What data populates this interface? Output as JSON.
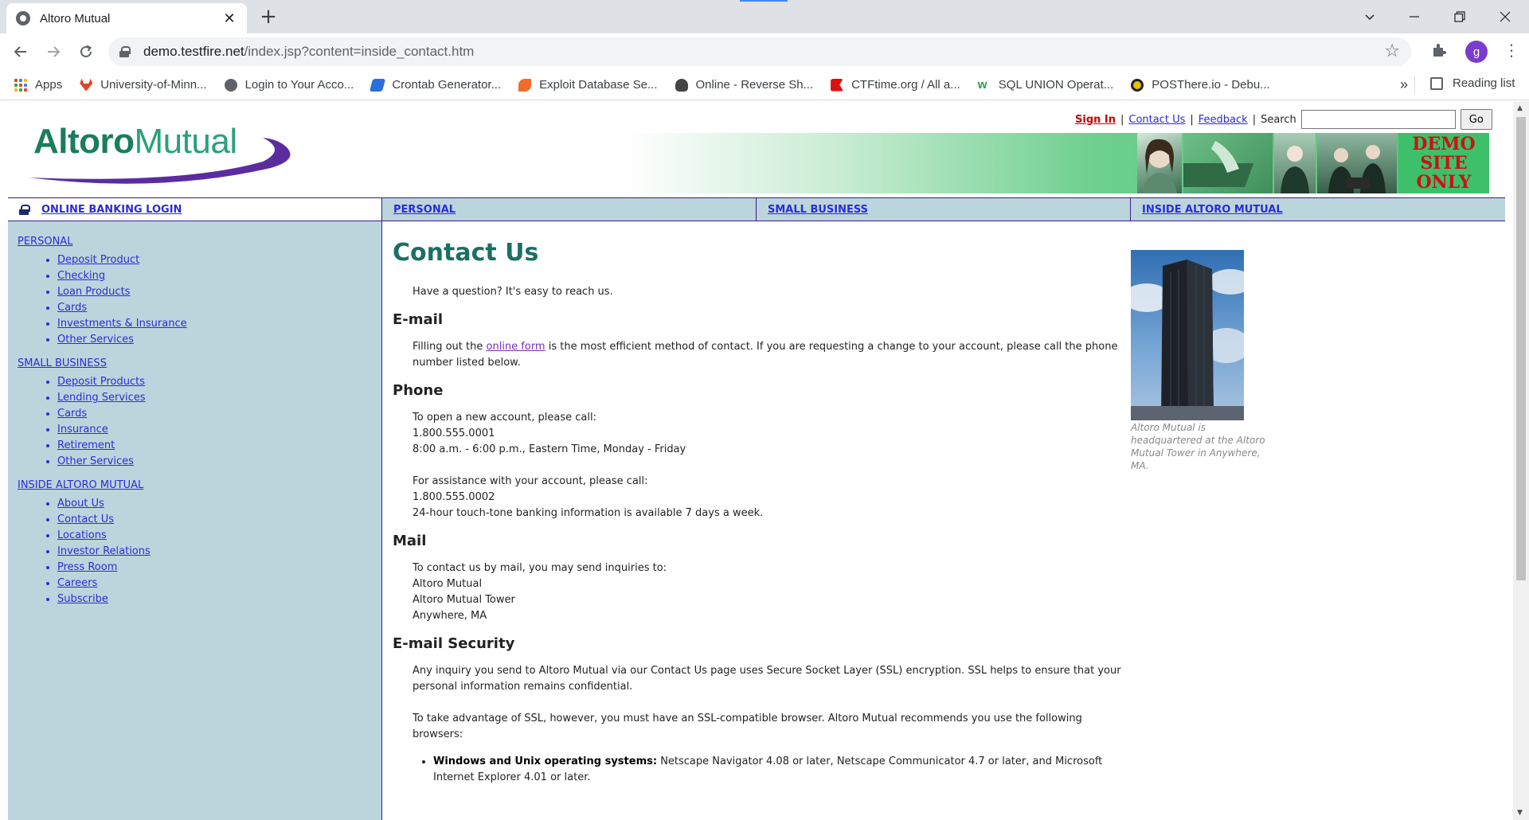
{
  "browser": {
    "tab_title": "Altoro Mutual",
    "tab_close": "✕",
    "new_tab": "+",
    "url_host": "demo.testfire.net",
    "url_path": "/index.jsp?content=inside_contact.htm",
    "avatar_letter": "g",
    "bookmarks": [
      {
        "label": "Apps",
        "icon": "apps-grid-icon",
        "color": "#4285f4"
      },
      {
        "label": "University-of-Minn...",
        "icon": "gitlab-icon",
        "color": "#e24329"
      },
      {
        "label": "Login to Your Acco...",
        "icon": "globe-icon",
        "color": "#5f6368"
      },
      {
        "label": "Crontab Generator...",
        "icon": "crontab-icon",
        "color": "#2a6fdb"
      },
      {
        "label": "Exploit Database Se...",
        "icon": "exploitdb-icon",
        "color": "#f26b2a"
      },
      {
        "label": "Online - Reverse Sh...",
        "icon": "skull-icon",
        "color": "#444444"
      },
      {
        "label": "CTFtime.org / All a...",
        "icon": "ctftime-icon",
        "color": "#e01010"
      },
      {
        "label": "SQL UNION Operat...",
        "icon": "w3schools-icon",
        "color": "#2e9a4a"
      },
      {
        "label": "POSThere.io - Debu...",
        "icon": "posthere-icon",
        "color": "#e6c100"
      }
    ],
    "bookmarks_more": "»",
    "reading_list": "Reading list"
  },
  "header": {
    "logo_bold": "Altoro",
    "logo_light": "Mutual",
    "sign_in": "Sign In",
    "contact_us": "Contact Us",
    "feedback": "Feedback",
    "search_label": "Search",
    "search_value": "",
    "go_label": "Go",
    "demo_badge": "DEMO SITE ONLY"
  },
  "nav": {
    "login": "ONLINE BANKING LOGIN",
    "personal": "PERSONAL",
    "small_business": "SMALL BUSINESS",
    "inside": "INSIDE ALTORO MUTUAL"
  },
  "sidebar": {
    "sections": [
      {
        "title": "PERSONAL",
        "items": [
          "Deposit Product",
          "Checking",
          "Loan Products",
          "Cards",
          "Investments & Insurance",
          "Other Services"
        ]
      },
      {
        "title": "SMALL BUSINESS",
        "items": [
          "Deposit Products",
          "Lending Services",
          "Cards",
          "Insurance",
          "Retirement",
          "Other Services"
        ]
      },
      {
        "title": "INSIDE ALTORO MUTUAL",
        "items": [
          "About Us",
          "Contact Us",
          "Locations",
          "Investor Relations",
          "Press Room",
          "Careers",
          "Subscribe"
        ]
      }
    ]
  },
  "content": {
    "title": "Contact Us",
    "intro": "Have a question? It's easy to reach us.",
    "email_heading": "E-mail",
    "email_pre": "Filling out the ",
    "email_link": "online form",
    "email_post": " is the most efficient method of contact. If you are requesting a change to your account, please call the phone number listed below.",
    "phone_heading": "Phone",
    "phone_new_1": "To open a new account, please call:",
    "phone_new_2": "1.800.555.0001",
    "phone_new_3": "8:00 a.m. - 6:00 p.m., Eastern Time, Monday - Friday",
    "phone_assist_1": "For assistance with your account, please call:",
    "phone_assist_2": "1.800.555.0002",
    "phone_assist_3": "24-hour touch-tone banking information is available 7 days a week.",
    "mail_heading": "Mail",
    "mail_1": "To contact us by mail, you may send inquiries to:",
    "mail_2": "Altoro Mutual",
    "mail_3": "Altoro Mutual Tower",
    "mail_4": "Anywhere, MA",
    "security_heading": "E-mail Security",
    "security_p1": "Any inquiry you send to Altoro Mutual via our Contact Us page uses Secure Socket Layer (SSL) encryption. SSL helps to ensure that your personal information remains confidential.",
    "security_p2": "To take advantage of SSL, however, you must have an SSL-compatible browser. Altoro Mutual recommends you use the following browsers:",
    "browsers_bold": "Windows and Unix operating systems:",
    "browsers_text": " Netscape Navigator 4.08 or later, Netscape Communicator 4.7 or later, and Microsoft Internet Explorer 4.01 or later."
  },
  "aside": {
    "caption": "Altoro Mutual is headquartered at the Altoro Mutual Tower in Anywhere, MA."
  }
}
